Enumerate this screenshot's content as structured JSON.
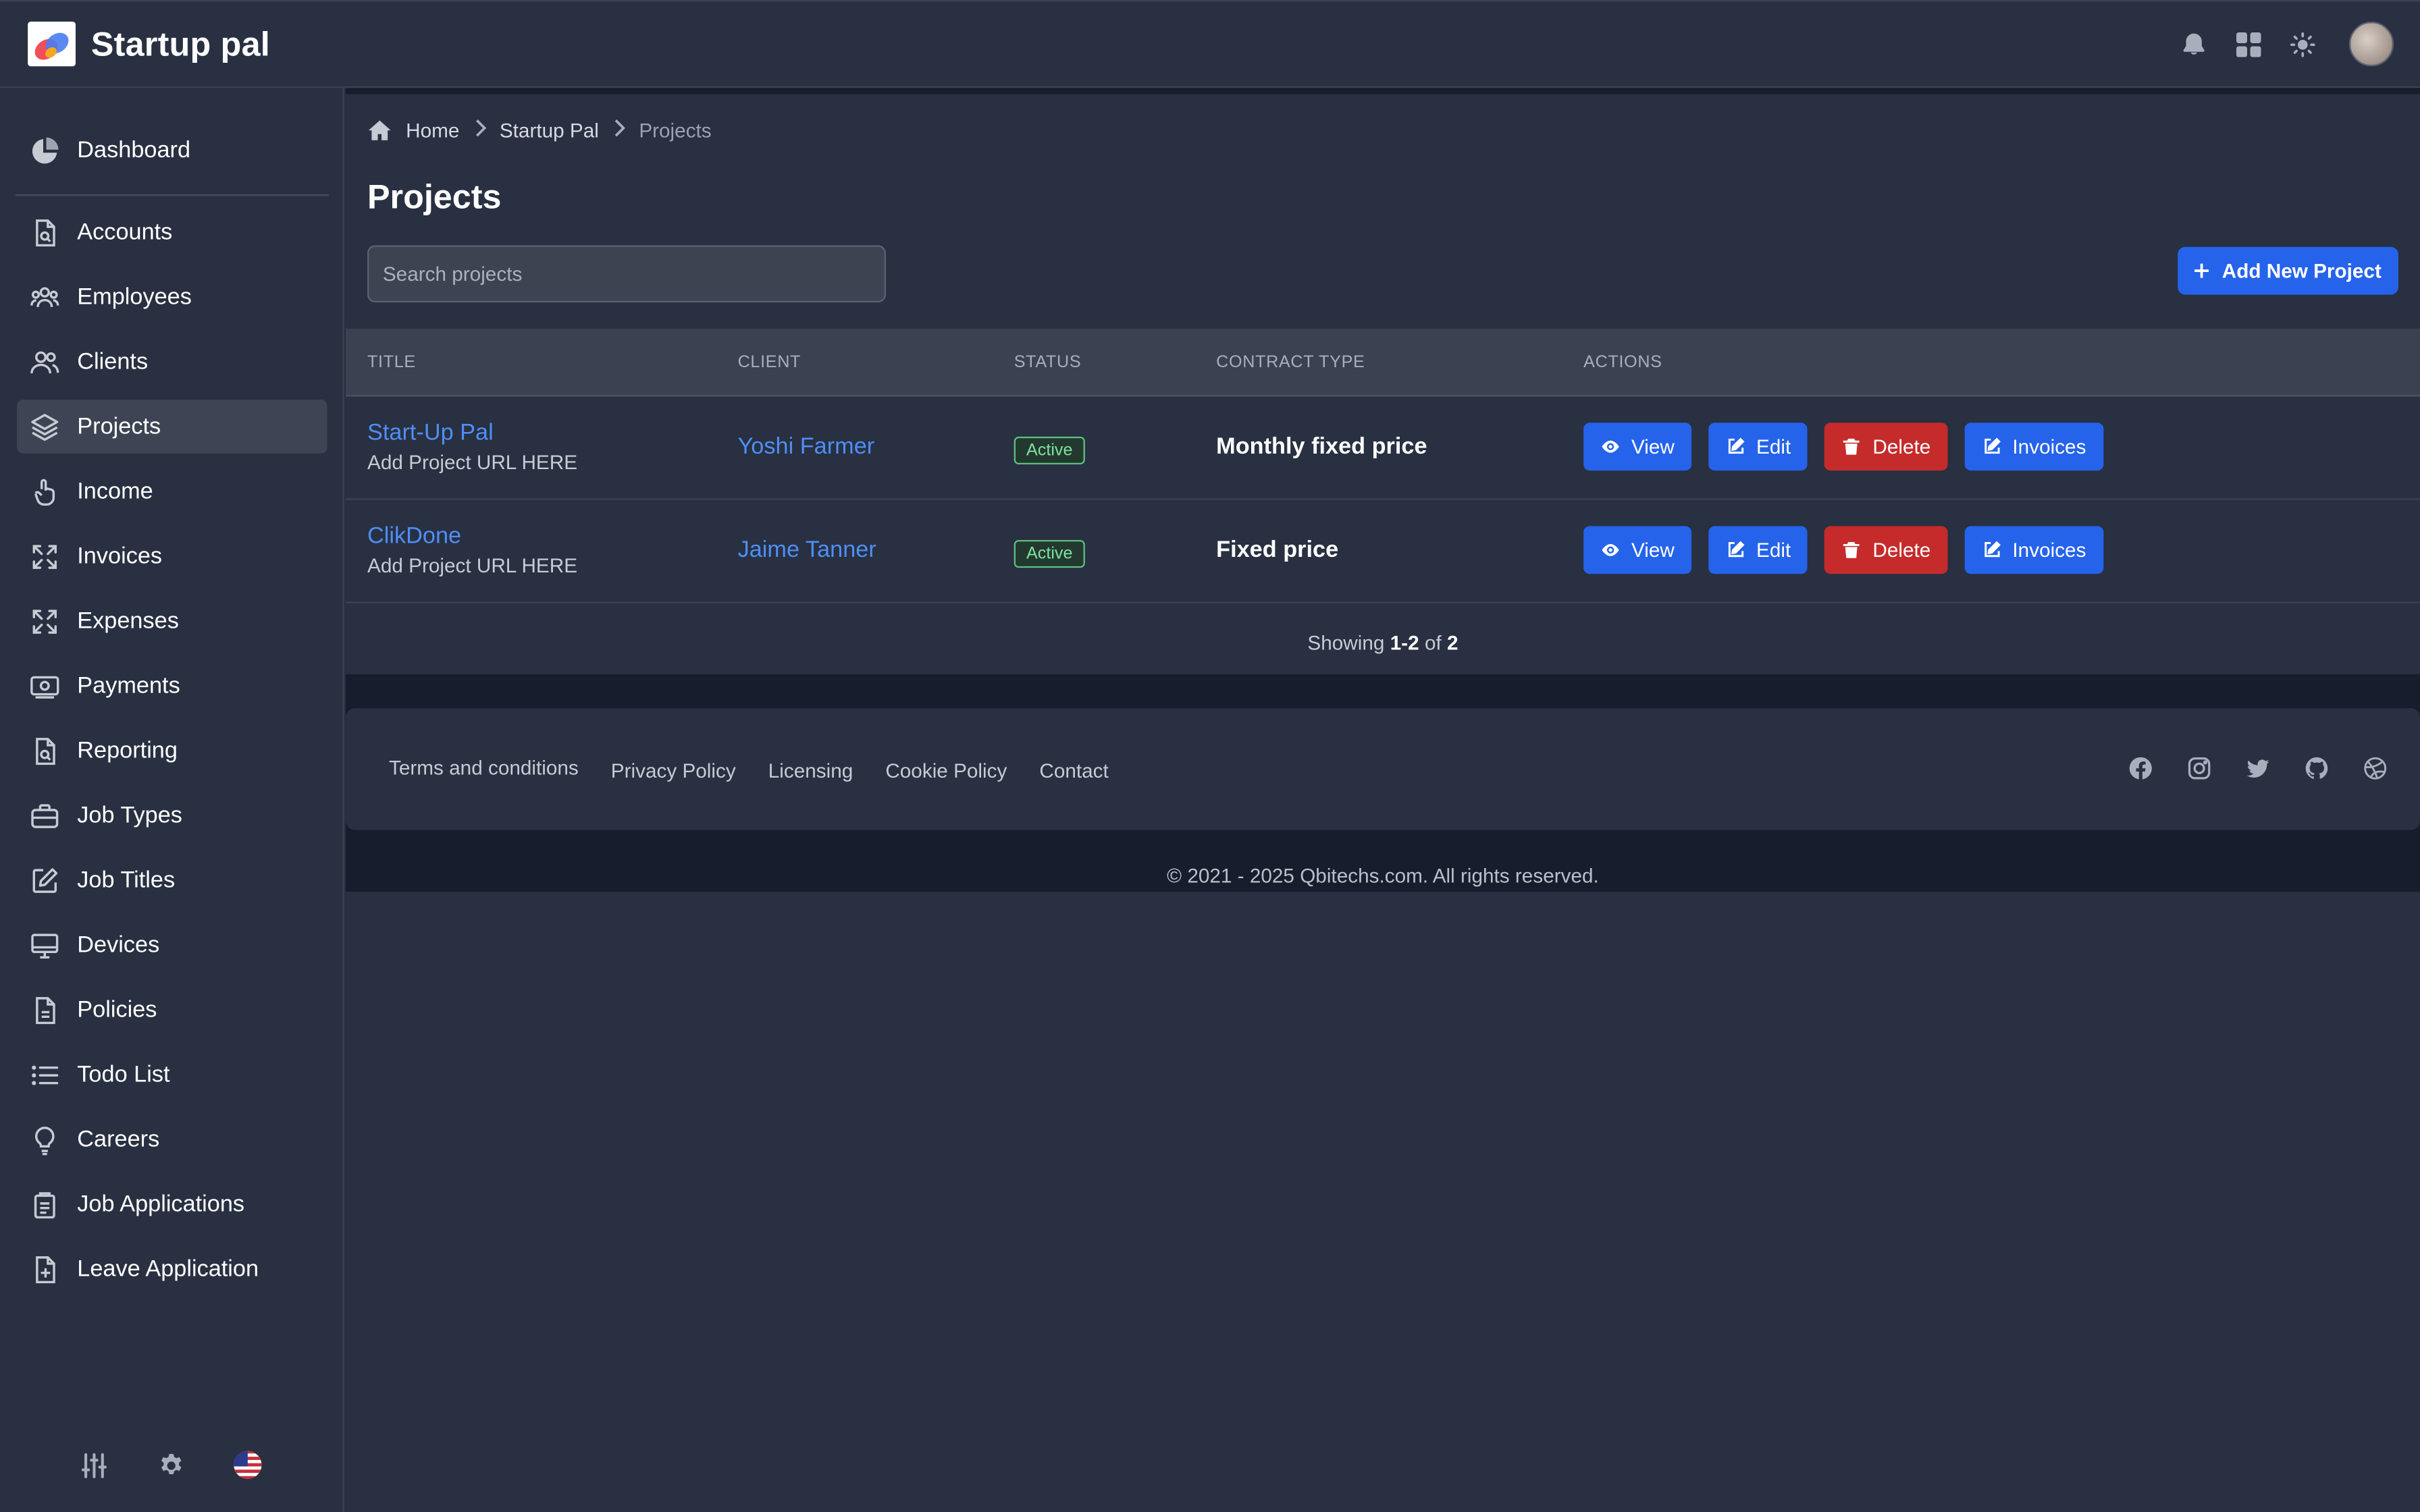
{
  "app": {
    "name": "Startup pal"
  },
  "sidebar": {
    "items": [
      {
        "label": "Dashboard",
        "icon": "pie-chart-icon"
      },
      {
        "label": "Accounts",
        "icon": "document-search-icon"
      },
      {
        "label": "Employees",
        "icon": "users-icon"
      },
      {
        "label": "Clients",
        "icon": "user-group-icon"
      },
      {
        "label": "Projects",
        "icon": "layers-icon",
        "active": true
      },
      {
        "label": "Income",
        "icon": "hand-coin-icon"
      },
      {
        "label": "Invoices",
        "icon": "arrows-expand-icon"
      },
      {
        "label": "Expenses",
        "icon": "arrows-expand-icon"
      },
      {
        "label": "Payments",
        "icon": "cash-icon"
      },
      {
        "label": "Reporting",
        "icon": "document-search-icon"
      },
      {
        "label": "Job Types",
        "icon": "briefcase-icon"
      },
      {
        "label": "Job Titles",
        "icon": "pencil-icon"
      },
      {
        "label": "Devices",
        "icon": "desktop-icon"
      },
      {
        "label": "Policies",
        "icon": "document-icon"
      },
      {
        "label": "Todo List",
        "icon": "list-icon"
      },
      {
        "label": "Careers",
        "icon": "lightbulb-icon"
      },
      {
        "label": "Job Applications",
        "icon": "clipboard-icon"
      },
      {
        "label": "Leave Application",
        "icon": "document-add-icon"
      }
    ]
  },
  "breadcrumb": {
    "home": "Home",
    "parent": "Startup Pal",
    "current": "Projects"
  },
  "page": {
    "title": "Projects"
  },
  "search": {
    "placeholder": "Search projects"
  },
  "add_button": {
    "label": "Add New Project"
  },
  "table": {
    "headers": {
      "title": "TITLE",
      "client": "CLIENT",
      "status": "STATUS",
      "contract": "CONTRACT TYPE",
      "actions": "ACTIONS"
    },
    "rows": [
      {
        "title": "Start-Up Pal",
        "url": "Add Project URL HERE",
        "client": "Yoshi Farmer",
        "status": "Active",
        "contract": "Monthly fixed price"
      },
      {
        "title": "ClikDone",
        "url": "Add Project URL HERE",
        "client": "Jaime Tanner",
        "status": "Active",
        "contract": "Fixed price"
      }
    ],
    "actions": {
      "view": "View",
      "edit": "Edit",
      "delete": "Delete",
      "invoices": "Invoices"
    }
  },
  "pagination": {
    "prefix": "Showing",
    "range": "1-2",
    "of": "of",
    "total": "2"
  },
  "footer": {
    "links": [
      "Terms and conditions",
      "Privacy Policy",
      "Licensing",
      "Cookie Policy",
      "Contact"
    ],
    "social": [
      "facebook-icon",
      "instagram-icon",
      "twitter-icon",
      "github-icon",
      "dribbble-icon"
    ],
    "copyright": "© 2021 - 2025 Qbitechs.com. All rights reserved."
  },
  "colors": {
    "primary": "#2563eb",
    "danger": "#c52b2b",
    "link": "#4f8ef7",
    "success": "#7ee2a0",
    "bg": "#283041"
  }
}
